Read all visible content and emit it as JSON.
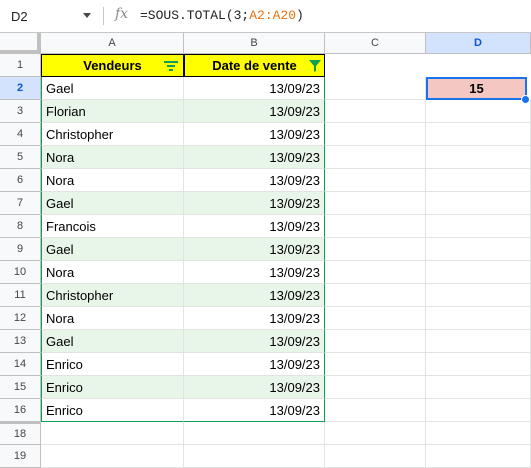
{
  "formula_bar": {
    "cell_ref": "D2",
    "fx_symbol": "fx",
    "formula_prefix": "=SOUS.TOTAL(3;",
    "formula_range": "A2:A20",
    "formula_suffix": ")"
  },
  "columns": [
    "A",
    "B",
    "C",
    "D"
  ],
  "selected_column": "D",
  "rows": [
    "1",
    "2",
    "3",
    "4",
    "5",
    "6",
    "7",
    "8",
    "9",
    "10",
    "11",
    "12",
    "13",
    "14",
    "15",
    "16",
    "18",
    "19"
  ],
  "selected_row": "2",
  "table": {
    "headers": [
      "Vendeurs",
      "Date de vente"
    ],
    "rows": [
      [
        "Gael",
        "13/09/23"
      ],
      [
        "Florian",
        "13/09/23"
      ],
      [
        "Christopher",
        "13/09/23"
      ],
      [
        "Nora",
        "13/09/23"
      ],
      [
        "Nora",
        "13/09/23"
      ],
      [
        "Gael",
        "13/09/23"
      ],
      [
        "Francois",
        "13/09/23"
      ],
      [
        "Gael",
        "13/09/23"
      ],
      [
        "Nora",
        "13/09/23"
      ],
      [
        "Christopher",
        "13/09/23"
      ],
      [
        "Nora",
        "13/09/23"
      ],
      [
        "Gael",
        "13/09/23"
      ],
      [
        "Enrico",
        "13/09/23"
      ],
      [
        "Enrico",
        "13/09/23"
      ],
      [
        "Enrico",
        "13/09/23"
      ]
    ]
  },
  "d2_value": "15",
  "icons": {
    "name_box_dropdown": "chevron-down-icon",
    "vendeurs_filter": "filter-lines-icon",
    "date_filter": "filter-active-icon"
  },
  "colors": {
    "header_fill": "#ffff00",
    "band_light": "#e8f5e9",
    "d2_fill": "#f4c7c3",
    "selection": "#1a73e8",
    "filter_green": "#0f9d58"
  }
}
